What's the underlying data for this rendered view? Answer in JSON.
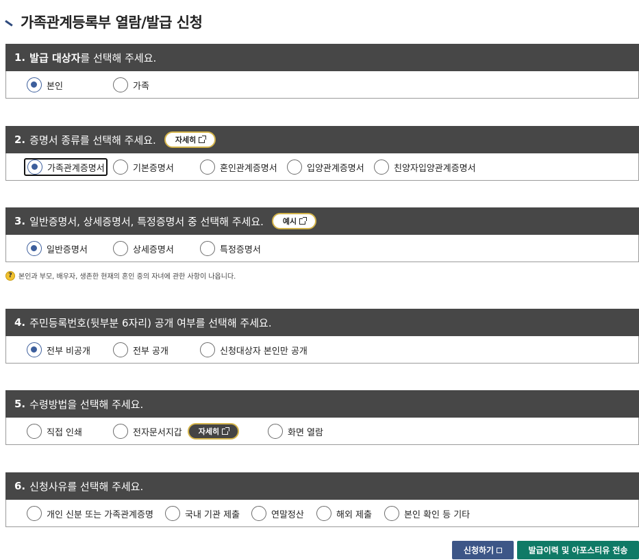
{
  "page": {
    "title": "가족관계등록부 열람/발급 신청"
  },
  "sections": [
    {
      "num": "1.",
      "bold": "발급 대상자",
      "rest": "를 선택해 주세요.",
      "options": [
        {
          "label": "본인",
          "selected": true
        },
        {
          "label": "가족",
          "selected": false
        }
      ]
    },
    {
      "num": "2.",
      "bold": "",
      "rest": "증명서 종류를 선택해 주세요.",
      "pill": "자세히",
      "options": [
        {
          "label": "가족관계증명서",
          "selected": true
        },
        {
          "label": "기본증명서",
          "selected": false
        },
        {
          "label": "혼인관계증명서",
          "selected": false
        },
        {
          "label": "입양관계증명서",
          "selected": false
        },
        {
          "label": "친양자입양관계증명서",
          "selected": false
        }
      ]
    },
    {
      "num": "3.",
      "bold": "",
      "rest": "일반증명서, 상세증명서, 특정증명서 중 선택해 주세요.",
      "pill": "예시",
      "options": [
        {
          "label": "일반증명서",
          "selected": true
        },
        {
          "label": "상세증명서",
          "selected": false
        },
        {
          "label": "특정증명서",
          "selected": false
        }
      ],
      "note": "본인과 부모, 배우자, 생존한 현재의 혼인 중의 자녀에 관한 사항이 나옵니다."
    },
    {
      "num": "4.",
      "bold": "",
      "rest": "주민등록번호(뒷부분 6자리) 공개 여부를 선택해 주세요.",
      "options": [
        {
          "label": "전부 비공개",
          "selected": true
        },
        {
          "label": "전부 공개",
          "selected": false
        },
        {
          "label": "신청대상자 본인만 공개",
          "selected": false
        }
      ]
    },
    {
      "num": "5.",
      "bold": "",
      "rest": "수령방법을 선택해 주세요.",
      "options": [
        {
          "label": "직접 인쇄",
          "selected": false
        },
        {
          "label": "전자문서지갑",
          "selected": false,
          "pill": "자세히"
        },
        {
          "label": "화면 열람",
          "selected": false
        }
      ]
    },
    {
      "num": "6.",
      "bold": "",
      "rest": "신청사유를 선택해 주세요.",
      "options": [
        {
          "label": "개인 신분 또는 가족관계증명",
          "selected": false
        },
        {
          "label": "국내 기관 제출",
          "selected": false
        },
        {
          "label": "연말정산",
          "selected": false
        },
        {
          "label": "해외 제출",
          "selected": false
        },
        {
          "label": "본인 확인 등 기타",
          "selected": false
        }
      ]
    }
  ],
  "buttons": {
    "apply": "신청하기",
    "send": "발급이력 및 아포스티유 전송"
  },
  "colors": {
    "header_bg": "#474747",
    "radio_selected": "#3c5e9c",
    "pill_border": "#d4b44a",
    "apply_button": "#3d5687",
    "send_button": "#0f7a66"
  }
}
